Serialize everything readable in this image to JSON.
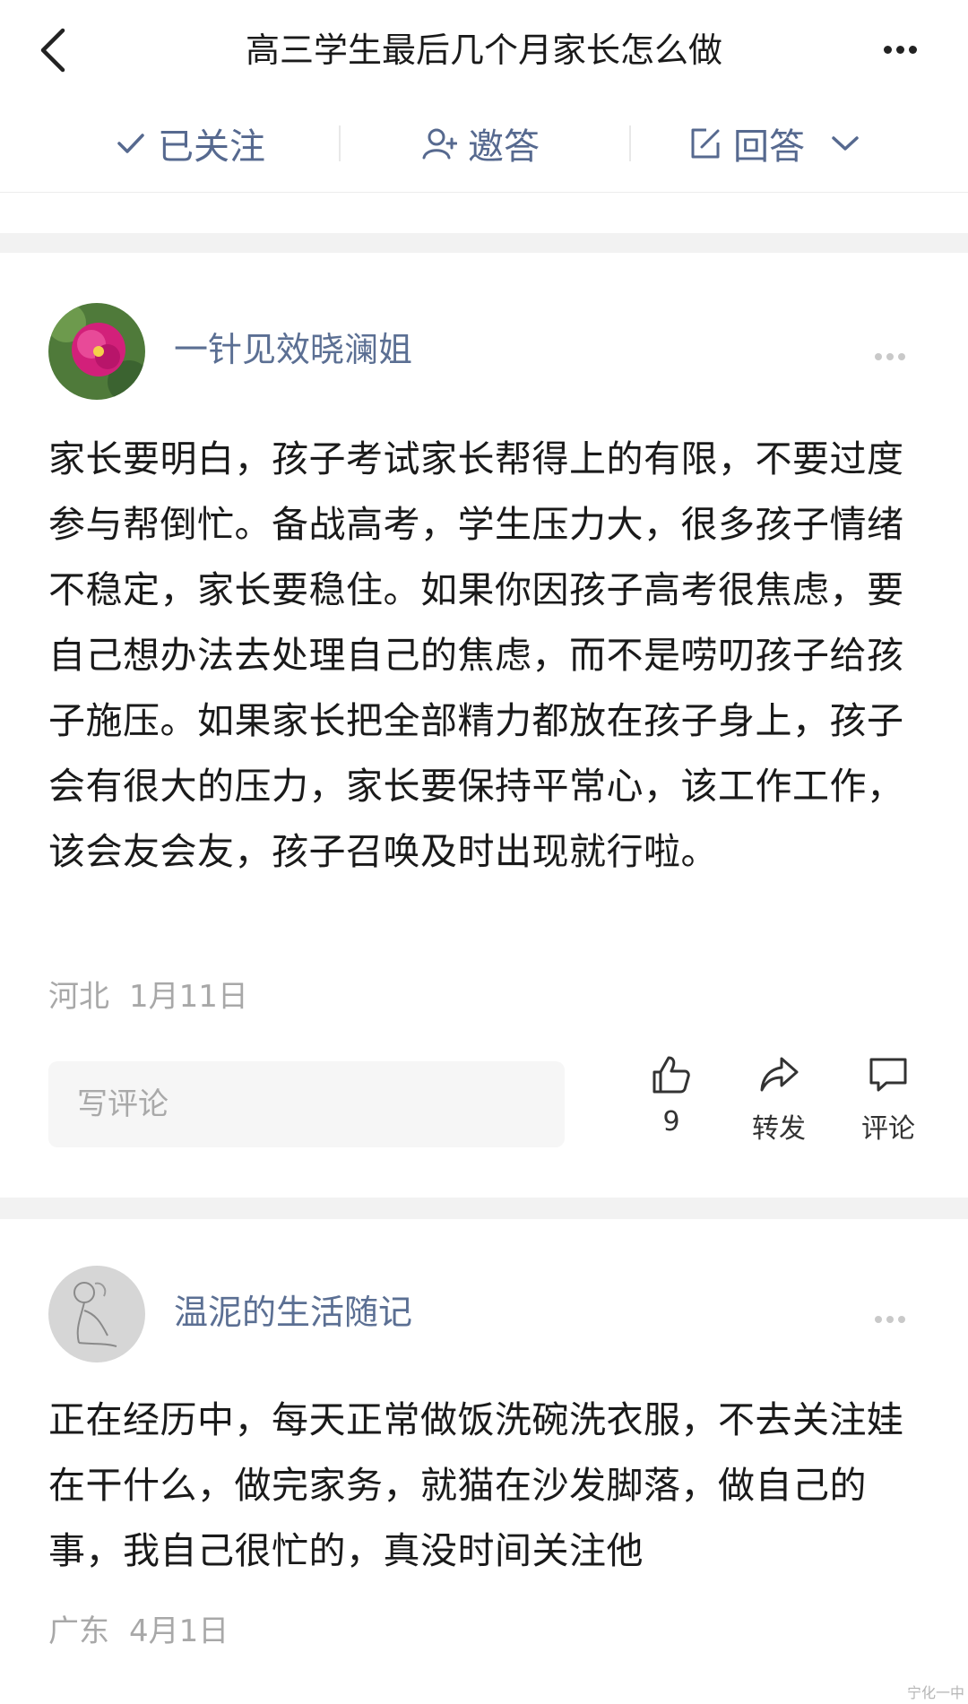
{
  "header": {
    "title": "高三学生最后几个月家长怎么做"
  },
  "actions": {
    "follow_label": "已关注",
    "invite_label": "邀答",
    "answer_label": "回答"
  },
  "answers": [
    {
      "author": "一针见效晓澜姐",
      "content": "家长要明白，孩子考试家长帮得上的有限，不要过度参与帮倒忙。备战高考，学生压力大，很多孩子情绪不稳定，家长要稳住。如果你因孩子高考很焦虑，要自己想办法去处理自己的焦虑，而不是唠叨孩子给孩子施压。如果家长把全部精力都放在孩子身上，孩子会有很大的压力，家长要保持平常心，该工作工作，该会友会友，孩子召唤及时出现就行啦。",
      "location": "河北",
      "date": "1月11日",
      "comment_placeholder": "写评论",
      "like_count": "9",
      "share_label": "转发",
      "comment_label": "评论"
    },
    {
      "author": "温泥的生活随记",
      "content": "正在经历中，每天正常做饭洗碗洗衣服，不去关注娃在干什么，做完家务，就猫在沙发脚落，做自己的事，我自己很忙的，真没时间关注他",
      "location": "广东",
      "date": "4月1日"
    }
  ],
  "watermark": "宁化一中",
  "colors": {
    "author": "#5b6f93",
    "action": "#56698f",
    "meta": "#a8a8a8",
    "band": "#f2f2f2"
  }
}
